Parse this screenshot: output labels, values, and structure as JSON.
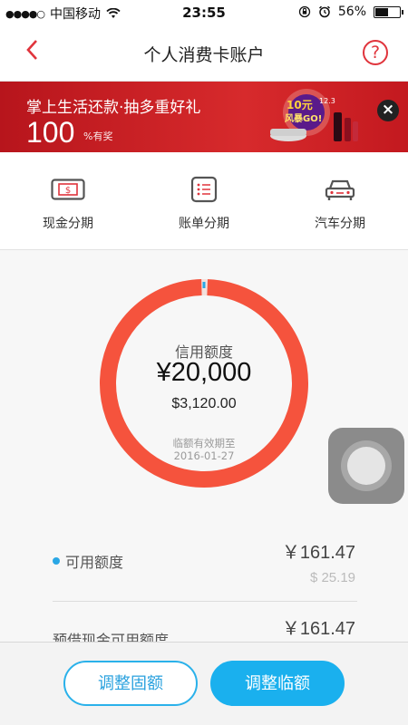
{
  "status_bar": {
    "signal_dots": "●●●●○",
    "carrier": "中国移动",
    "time": "23:55",
    "battery": "56%",
    "battery_level": 0.56
  },
  "nav": {
    "back_icon": "chevron-left-icon",
    "title": "个人消费卡账户",
    "help_icon": "question-icon",
    "help_glyph": "?"
  },
  "banner": {
    "line1": "掌上生活还款·抽多重好礼",
    "big_number": "100",
    "suffix": "%有奖",
    "art_text_1": "10元",
    "art_text_2": "风暴GO!",
    "art_text_3": "12.3",
    "close_glyph": "×"
  },
  "features": [
    {
      "label": "现金分期",
      "icon": "cash-icon"
    },
    {
      "label": "账单分期",
      "icon": "bill-icon"
    },
    {
      "label": "汽车分期",
      "icon": "car-icon"
    }
  ],
  "credit": {
    "label": "信用额度",
    "amount": "¥20,000",
    "sub_amount": "$3,120.00",
    "expiry_label": "临额有效期至",
    "expiry_date": "2016-01-27",
    "used_fraction": 0.99
  },
  "rows": [
    {
      "name": "可用额度",
      "value": "￥161.47",
      "value2": "$ 25.19"
    },
    {
      "name": "预借现金可用额度",
      "value": "￥161.47"
    }
  ],
  "buttons": {
    "adjust_fixed": "调整固额",
    "adjust_temp": "调整临额"
  },
  "colors": {
    "brand_red": "#e0343c",
    "ring": "#f5533d",
    "accent_blue": "#1ab0ee"
  }
}
